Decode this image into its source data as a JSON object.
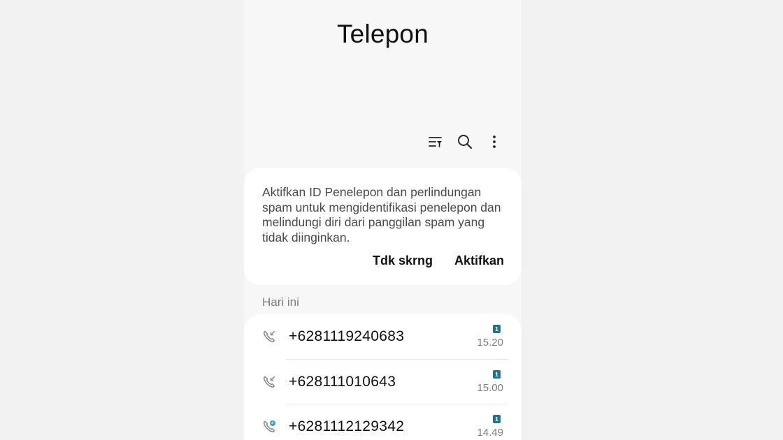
{
  "header": {
    "title": "Telepon"
  },
  "toolbar": {
    "icons": [
      "filter-icon",
      "search-icon",
      "more-options-icon"
    ]
  },
  "banner": {
    "message": "Aktifkan ID Penelepon dan perlindungan spam untuk mengidentifikasi penelepon dan melindungi diri dari panggilan spam yang tidak diinginkan.",
    "dismiss_label": "Tdk skrng",
    "enable_label": "Aktifkan"
  },
  "section": {
    "label": "Hari ini"
  },
  "calls": [
    {
      "number": "+6281119240683",
      "time": "15.20",
      "sim": "1",
      "icon": "incoming-call-icon"
    },
    {
      "number": "+628111010643",
      "time": "15.00",
      "sim": "1",
      "icon": "incoming-call-icon"
    },
    {
      "number": "+6281112129342",
      "time": "14.49",
      "sim": "1",
      "icon": "video-call-icon"
    }
  ],
  "colors": {
    "sim_badge": "#26708f",
    "background": "#f7f7f7",
    "card": "#ffffff"
  }
}
